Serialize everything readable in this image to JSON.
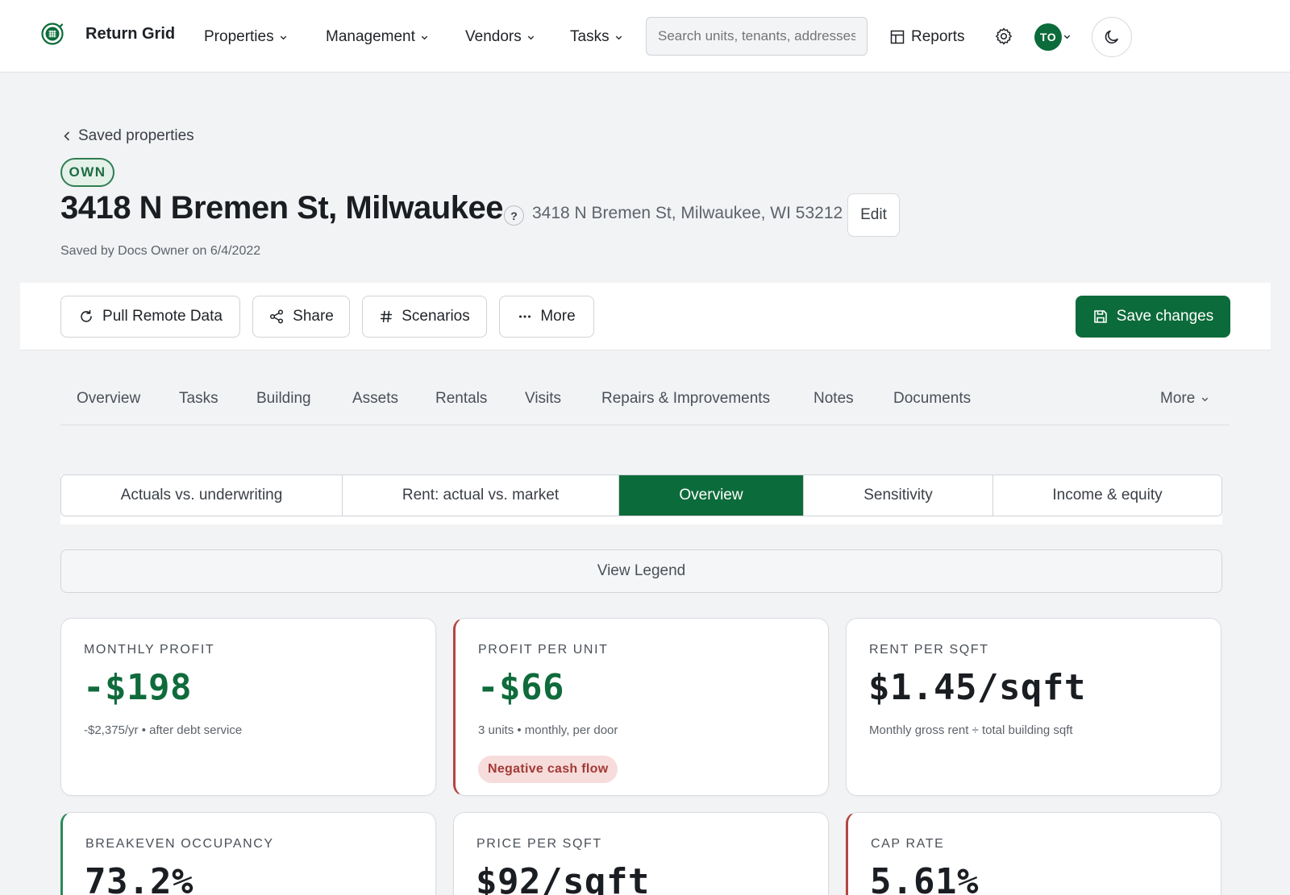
{
  "brand": {
    "name": "Return Grid",
    "icon": "grid-globe-icon"
  },
  "nav": {
    "items": [
      "Properties",
      "Management",
      "Vendors",
      "Tasks"
    ],
    "search_placeholder": "Search units, tenants, addresses",
    "reports_label": "Reports",
    "avatar_initials": "TO"
  },
  "header": {
    "back_label": "Saved properties",
    "badge": "OWN",
    "title": "3418 N Bremen St, Milwaukee",
    "help_glyph": "?",
    "address": "3418 N Bremen St, Milwaukee, WI 53212",
    "edit_label": "Edit",
    "saved_by": "Saved by Docs Owner on 6/4/2022"
  },
  "actions": {
    "pull_label": "Pull Remote Data",
    "share_label": "Share",
    "scenarios_label": "Scenarios",
    "more_label": "More",
    "save_label": "Save changes"
  },
  "section_tabs": [
    "Overview",
    "Tasks",
    "Building",
    "Assets",
    "Rentals",
    "Visits",
    "Repairs & Improvements",
    "Notes",
    "Documents"
  ],
  "section_more": "More",
  "segments": {
    "options": [
      "Actuals vs. underwriting",
      "Rent: actual vs. market",
      "Overview",
      "Sensitivity",
      "Income & equity"
    ],
    "active": "Overview"
  },
  "legend_label": "View Legend",
  "cards": [
    {
      "label": "MONTHLY PROFIT",
      "value": "-$198",
      "sub": "-$2,375/yr • after debt service"
    },
    {
      "label": "PROFIT PER UNIT",
      "value": "-$66",
      "sub": "3 units • monthly, per door",
      "badge": "Negative cash flow"
    },
    {
      "label": "RENT PER SQFT",
      "value": "$1.45/sqft",
      "sub": "Monthly gross rent ÷ total building sqft"
    },
    {
      "label": "BREAKEVEN OCCUPANCY",
      "value": "73.2%"
    },
    {
      "label": "PRICE PER SQFT",
      "value": "$92/sqft"
    },
    {
      "label": "CAP RATE",
      "value": "5.61%"
    }
  ],
  "colors": {
    "brand_green": "#0c6b3a",
    "value_green": "#0f6b3b",
    "negative_red": "#b5453f",
    "negative_badge_bg": "#f6dcdb"
  }
}
